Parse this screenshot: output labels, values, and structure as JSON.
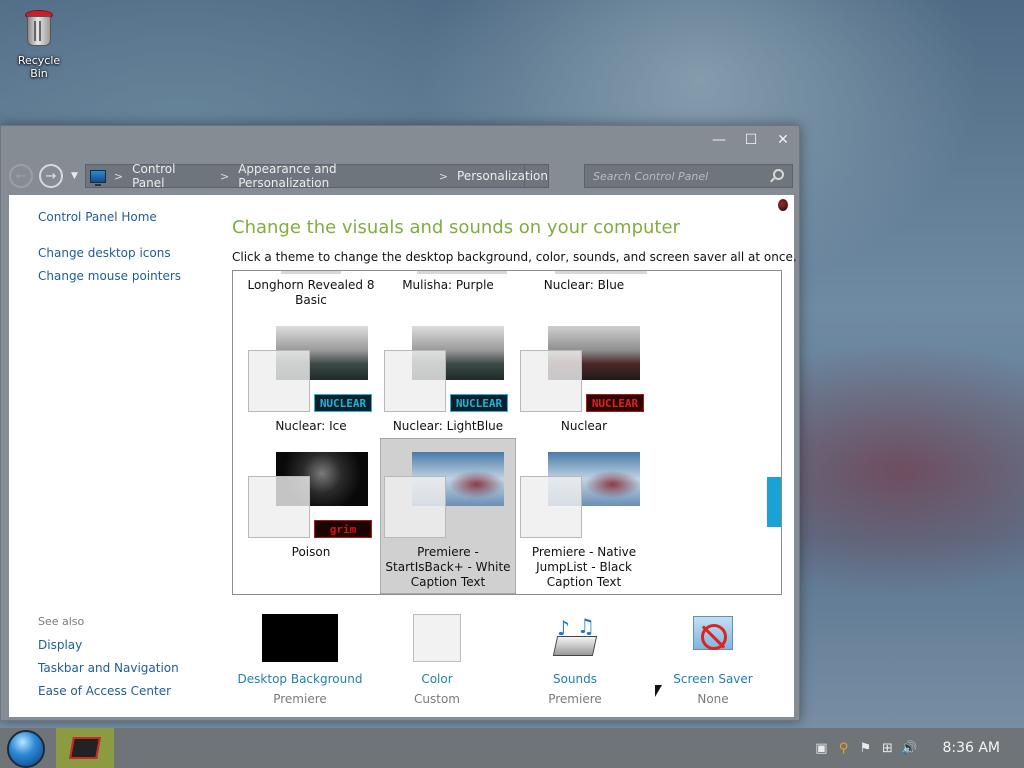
{
  "desktop": {
    "recycle_bin_label": "Recycle Bin"
  },
  "window": {
    "caption": {
      "minimize": "—",
      "maximize": "☐",
      "close": "✕"
    },
    "nav": {
      "back": "←",
      "forward": "→",
      "recent": "▼"
    },
    "breadcrumbs": [
      "Control Panel",
      "Appearance and Personalization",
      "Personalization"
    ],
    "breadcrumb_sep": ">",
    "search_placeholder": "Search Control Panel"
  },
  "sidebar": {
    "home": "Control Panel Home",
    "links": [
      "Change desktop icons",
      "Change mouse pointers"
    ],
    "see_also_title": "See also",
    "see_also": [
      "Display",
      "Taskbar and Navigation",
      "Ease of Access Center"
    ]
  },
  "main": {
    "title": "Change the visuals and sounds on your computer",
    "description": "Click a theme to change the desktop background, color, sounds, and screen saver all at once.",
    "themes_row1": [
      "Longhorn Revealed 8\nBasic",
      "Mulisha: Purple",
      "Nuclear: Blue"
    ],
    "themes_row2": [
      "Nuclear: Ice",
      "Nuclear: LightBlue",
      "Nuclear"
    ],
    "themes_row3": [
      "Poison",
      "Premiere -\nStartIsBack+ - White\nCaption Text",
      "Premiere - Native\nJumpList - Black\nCaption Text"
    ],
    "logos": {
      "nuclear": "NUCLEAR",
      "grim": "grim"
    },
    "selected_theme": "Premiere - StartIsBack+ - White Caption Text"
  },
  "bottom": {
    "desktop_background": {
      "title": "Desktop Background",
      "value": "Premiere"
    },
    "color": {
      "title": "Color",
      "value": "Custom"
    },
    "sounds": {
      "title": "Sounds",
      "value": "Premiere"
    },
    "screen_saver": {
      "title": "Screen Saver",
      "value": "None"
    }
  },
  "taskbar": {
    "clock": "8:36 AM"
  },
  "colors": {
    "accent_green": "#7fae3d",
    "link_blue": "#1e5c96",
    "scroll_accent": "#1aa1d6"
  }
}
